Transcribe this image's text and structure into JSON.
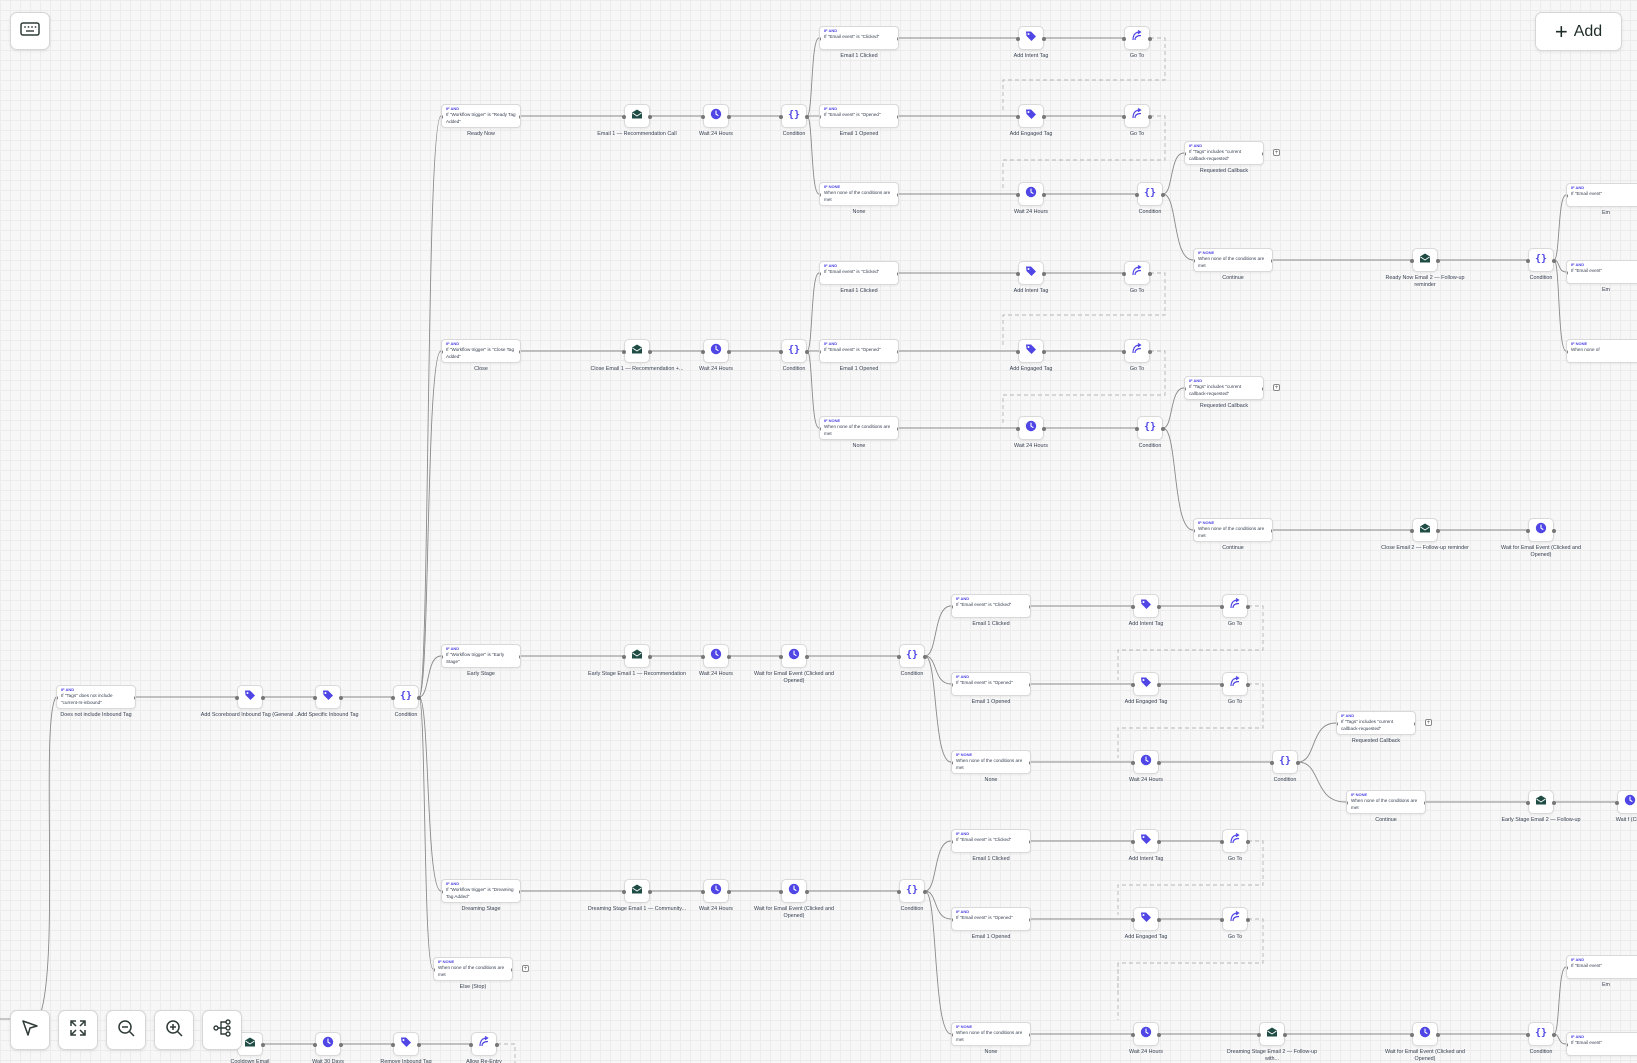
{
  "header": {
    "add_label": "Add"
  },
  "icons": {
    "keyboard": "keyboard-icon",
    "plus": "plus-icon",
    "pointer": "cursor-pointer-icon",
    "fit": "fit-view-icon",
    "zoom_out": "zoom-out-icon",
    "zoom_in": "zoom-in-icon",
    "layout": "auto-layout-icon"
  },
  "colors": {
    "accent": "#4f46e5",
    "email": "#1f4d45",
    "edge": "#8a8a8a",
    "dashed": "#b5b5b5"
  },
  "workflow": {
    "conditions": [
      {
        "id": "c1",
        "tag": "IF AND",
        "text": "If \"Email event\" is \"Clicked\"",
        "label": "Email 1 Clicked"
      },
      {
        "id": "c2",
        "tag": "IF AND",
        "text": "If \"Workflow trigger\" is \"Ready Tag Added\"",
        "label": "Ready Now"
      },
      {
        "id": "c3",
        "tag": "IF AND",
        "text": "If \"Email event\" is \"Opened\"",
        "label": "Email 1 Opened"
      },
      {
        "id": "c4",
        "tag": "IF AND",
        "text": "If \"Tags\" includes \"current callback-requested\"",
        "label": "Requested Callback"
      },
      {
        "id": "c5",
        "tag": "IF NONE",
        "text": "When none of the conditions are met",
        "label": "None"
      },
      {
        "id": "c6",
        "tag": "IF NONE",
        "text": "When none of the conditions are met",
        "label": "Continue"
      },
      {
        "id": "c7",
        "tag": "IF AND",
        "text": "If \"Email event\" is \"Clicked\"",
        "label": "Email 1 Clicked"
      },
      {
        "id": "c8",
        "tag": "IF AND",
        "text": "If \"Workflow trigger\" is \"Close Tag Added\"",
        "label": "Close"
      },
      {
        "id": "c9",
        "tag": "IF AND",
        "text": "If \"Email event\" is \"Opened\"",
        "label": "Email 1 Opened"
      },
      {
        "id": "c10",
        "tag": "IF AND",
        "text": "If \"Tags\" includes \"current callback-requested\"",
        "label": "Requested Callback"
      },
      {
        "id": "c11",
        "tag": "IF NONE",
        "text": "When none of the conditions are met",
        "label": "None"
      },
      {
        "id": "c12",
        "tag": "IF NONE",
        "text": "When none of the conditions are met",
        "label": "Continue"
      },
      {
        "id": "c13",
        "tag": "IF AND",
        "text": "If \"Email event\" is \"Clicked\"",
        "label": "Email 1 Clicked"
      },
      {
        "id": "c14",
        "tag": "IF AND",
        "text": "If \"Workflow trigger\" is \"Early Stage\"",
        "label": "Early Stage"
      },
      {
        "id": "c15",
        "tag": "IF AND",
        "text": "If \"Email event\" is \"Opened\"",
        "label": "Email 1 Opened"
      },
      {
        "id": "c16",
        "tag": "IF AND",
        "text": "If \"Tags\" does not include \"current-rs-inbound\"",
        "label": "Does not include Inbound Tag"
      },
      {
        "id": "c17",
        "tag": "IF AND",
        "text": "If \"Tags\" includes \"current callback-requested\"",
        "label": "Requested Callback"
      },
      {
        "id": "c18",
        "tag": "IF NONE",
        "text": "When none of the conditions are met",
        "label": "None"
      },
      {
        "id": "c19",
        "tag": "IF NONE",
        "text": "When none of the conditions are met",
        "label": "Continue"
      },
      {
        "id": "c20",
        "tag": "IF AND",
        "text": "If \"Email event\" is \"Clicked\"",
        "label": "Email 1 Clicked"
      },
      {
        "id": "c21",
        "tag": "IF AND",
        "text": "If \"Workflow trigger\" is \"Dreaming Tag Added\"",
        "label": "Dreaming Stage"
      },
      {
        "id": "c22",
        "tag": "IF AND",
        "text": "If \"Email event\" is \"Opened\"",
        "label": "Email 1 Opened"
      },
      {
        "id": "c23",
        "tag": "IF NONE",
        "text": "When none of the conditions are met",
        "label": "Else (Stop)"
      },
      {
        "id": "c24",
        "tag": "IF NONE",
        "text": "When none of the conditions are met",
        "label": "None"
      },
      {
        "id": "c25",
        "tag": "IF AND",
        "text": "If \"Email event\"",
        "label": "Em"
      },
      {
        "id": "c26",
        "tag": "IF AND",
        "text": "If \"Email event\"",
        "label": "Em"
      },
      {
        "id": "c27",
        "tag": "IF NONE",
        "text": "When none of",
        "label": ""
      },
      {
        "id": "c28",
        "tag": "IF AND",
        "text": "If \"Email event\"",
        "label": "Em"
      },
      {
        "id": "c29",
        "tag": "IF AND",
        "text": "If \"Email event\"",
        "label": ""
      }
    ],
    "actions": [
      {
        "id": "a1",
        "type": "tag",
        "label": "Add Intent Tag"
      },
      {
        "id": "a2",
        "type": "goto",
        "label": "Go To"
      },
      {
        "id": "a3",
        "type": "email",
        "label": "Email 1 — Recommendation Call"
      },
      {
        "id": "a4",
        "type": "wait",
        "label": "Wait 24 Hours"
      },
      {
        "id": "a5",
        "type": "condition",
        "label": "Condition"
      },
      {
        "id": "a6",
        "type": "tag",
        "label": "Add Engaged Tag"
      },
      {
        "id": "a7",
        "type": "goto",
        "label": "Go To"
      },
      {
        "id": "a8",
        "type": "wait",
        "label": "Wait 24 Hours"
      },
      {
        "id": "a9",
        "type": "condition",
        "label": "Condition"
      },
      {
        "id": "a10",
        "type": "email",
        "label": "Ready Now Email 2 — Follow-up reminder"
      },
      {
        "id": "a11",
        "type": "condition",
        "label": "Condition"
      },
      {
        "id": "a12",
        "type": "tag",
        "label": "Add Intent Tag"
      },
      {
        "id": "a13",
        "type": "goto",
        "label": "Go To"
      },
      {
        "id": "a14",
        "type": "email",
        "label": "Close Email 1 — Recommendation +..."
      },
      {
        "id": "a15",
        "type": "wait",
        "label": "Wait 24 Hours"
      },
      {
        "id": "a16",
        "type": "condition",
        "label": "Condition"
      },
      {
        "id": "a17",
        "type": "tag",
        "label": "Add Engaged Tag"
      },
      {
        "id": "a18",
        "type": "goto",
        "label": "Go To"
      },
      {
        "id": "a19",
        "type": "wait",
        "label": "Wait 24 Hours"
      },
      {
        "id": "a20",
        "type": "condition",
        "label": "Condition"
      },
      {
        "id": "a21",
        "type": "email",
        "label": "Close Email 2 — Follow-up reminder"
      },
      {
        "id": "a22",
        "type": "wait",
        "label": "Wait for Email Event (Clicked and Opened)"
      },
      {
        "id": "a23",
        "type": "tag",
        "label": "Add Intent Tag"
      },
      {
        "id": "a24",
        "type": "goto",
        "label": "Go To"
      },
      {
        "id": "a25",
        "type": "email",
        "label": "Early Stage Email 1 — Recommendation"
      },
      {
        "id": "a26",
        "type": "wait",
        "label": "Wait 24 Hours"
      },
      {
        "id": "a27",
        "type": "wait",
        "label": "Wait for Email Event (Clicked and Opened)"
      },
      {
        "id": "a28",
        "type": "condition",
        "label": "Condition"
      },
      {
        "id": "a29",
        "type": "tag",
        "label": "Add Engaged Tag"
      },
      {
        "id": "a30",
        "type": "goto",
        "label": "Go To"
      },
      {
        "id": "a31",
        "type": "tag",
        "label": "Add Scoreboard Inbound Tag (General ..."
      },
      {
        "id": "a32",
        "type": "tag",
        "label": "Add Specific Inbound Tag"
      },
      {
        "id": "a33",
        "type": "condition",
        "label": "Condition"
      },
      {
        "id": "a34",
        "type": "wait",
        "label": "Wait 24 Hours"
      },
      {
        "id": "a35",
        "type": "condition",
        "label": "Condition"
      },
      {
        "id": "a36",
        "type": "email",
        "label": "Early Stage Email 2 — Follow-up"
      },
      {
        "id": "a37",
        "type": "wait",
        "label": "Wait f (Click"
      },
      {
        "id": "a38",
        "type": "tag",
        "label": "Add Intent Tag"
      },
      {
        "id": "a39",
        "type": "goto",
        "label": "Go To"
      },
      {
        "id": "a40",
        "type": "email",
        "label": "Dreaming Stage Email 1 — Community..."
      },
      {
        "id": "a41",
        "type": "wait",
        "label": "Wait 24 Hours"
      },
      {
        "id": "a42",
        "type": "wait",
        "label": "Wait for Email Event (Clicked and Opened)"
      },
      {
        "id": "a43",
        "type": "condition",
        "label": "Condition"
      },
      {
        "id": "a44",
        "type": "tag",
        "label": "Add Engaged Tag"
      },
      {
        "id": "a45",
        "type": "goto",
        "label": "Go To"
      },
      {
        "id": "a46",
        "type": "wait",
        "label": "Wait 24 Hours"
      },
      {
        "id": "a47",
        "type": "email",
        "label": "Dreaming Stage Email 2 — Follow-up with..."
      },
      {
        "id": "a48",
        "type": "wait",
        "label": "Wait for Email Event (Clicked and Opened)"
      },
      {
        "id": "a49",
        "type": "condition",
        "label": "Condition"
      },
      {
        "id": "a50",
        "type": "email",
        "label": "Cooldown Email"
      },
      {
        "id": "a51",
        "type": "wait",
        "label": "Wait 30 Days"
      },
      {
        "id": "a52",
        "type": "tag",
        "label": "Remove Inbound Tag"
      },
      {
        "id": "a53",
        "type": "goto",
        "label": "Allow Re-Entry"
      }
    ]
  }
}
